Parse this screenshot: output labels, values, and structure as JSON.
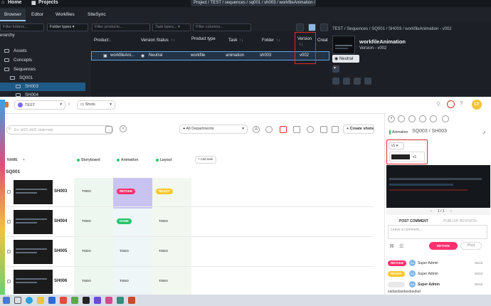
{
  "top_app": {
    "nav": {
      "home": "Home",
      "projects": "Projects"
    },
    "breadcrumb": "Project / TEST / sequences / sq001 / sh003 / workfileAnimation / v002",
    "tabs": [
      "Browser",
      "Editor",
      "Workfiles",
      "SiteSync"
    ],
    "filters": {
      "folders_placeholder": "Filter folders...",
      "folder_types": "Folder types",
      "products_placeholder": "Filter products...",
      "task_types": "Task types...",
      "columns_placeholder": "Filter columns..."
    },
    "hierarchy_label": "erarchy",
    "tree": [
      {
        "label": "Assets",
        "selected": false
      },
      {
        "label": "Concepts",
        "selected": false
      },
      {
        "label": "Sequences",
        "selected": false
      },
      {
        "label": "SQ001",
        "selected": false
      },
      {
        "label": "SH003",
        "selected": true
      },
      {
        "label": "SH004",
        "selected": false
      }
    ],
    "grid_headers": [
      "Product",
      "Version Status",
      "Product type",
      "Task",
      "Folder",
      "Version",
      "Creat"
    ],
    "grid_row": {
      "product": "workfileAni...",
      "status": "Neutral",
      "product_type": "workfile",
      "task": "animation",
      "folder": "sh003",
      "version": "v002"
    },
    "detail": {
      "breadcrumb": "TEST / Sequences / SQ001 / SH003 / workfileAnimation - v002",
      "title": "workfileAnimation",
      "subtitle": "Version - v002",
      "status": "Neutral"
    },
    "accent": "#1e5a86",
    "highlight": "#e02b2b"
  },
  "web_app": {
    "project": "TEST",
    "page": "Shots",
    "search_placeholder": "Ex: sh01 sh02 state=wip",
    "department": "All Departments",
    "create_label": "+ Create shots",
    "columns": {
      "name": "NAME",
      "storyboard": "Storyboard",
      "animation": "Animation",
      "layout": "Layout",
      "add_task": "+ Add task"
    },
    "sequence": "SQ001",
    "shots": [
      {
        "name": "SH003",
        "storyboard": "TODO",
        "animation": "RETAKE",
        "layout": "READY"
      },
      {
        "name": "SH004",
        "storyboard": "TODO",
        "animation": "DONE",
        "layout": "TODO"
      },
      {
        "name": "SH005",
        "storyboard": "TODO",
        "animation": "TODO",
        "layout": "TODO"
      },
      {
        "name": "SH006",
        "storyboard": "TODO",
        "animation": "TODO",
        "layout": "TODO"
      }
    ],
    "avatar_initials": "LY",
    "panel": {
      "task_label": "Animation",
      "title": "SQ003 / SH003",
      "version_select": "v1",
      "version_option": "v1",
      "player_page": "1 / 1",
      "tab_comment": "POST COMMENT",
      "tab_revision": "PUBLISH REVISION",
      "comment_placeholder": "Leave a comment...",
      "status_button": "RETAKE",
      "post_button": "Post",
      "history": [
        {
          "status": "RETAKE",
          "initials": "SA",
          "user": "Super Admin",
          "date": "06/23"
        },
        {
          "status": "READY",
          "initials": "SA",
          "user": "Super Admin",
          "date": "06/23"
        },
        {
          "status": "",
          "initials": "SA",
          "user": "Super Admin",
          "date": "06/15"
        }
      ],
      "last_comment": "sadasdasdasdasdad"
    }
  }
}
